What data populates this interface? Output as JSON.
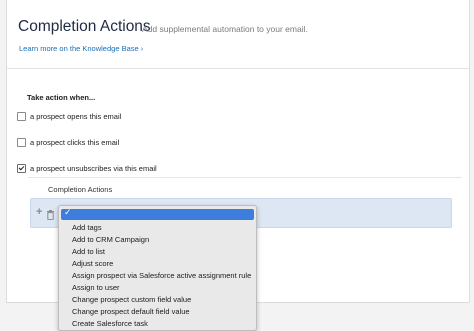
{
  "header": {
    "title": "Completion Actions",
    "subtitle": "Add supplemental automation to your email.",
    "kb_link": "Learn more on the Knowledge Base ›"
  },
  "trigger": {
    "heading": "Take action when...",
    "options": [
      {
        "label": "a prospect opens this email",
        "checked": false
      },
      {
        "label": "a prospect clicks this email",
        "checked": false
      },
      {
        "label": "a prospect unsubscribes via this email",
        "checked": true
      }
    ]
  },
  "completion_panel": {
    "title": "Completion Actions",
    "add_icon": "plus-icon",
    "delete_icon": "trash-icon"
  },
  "dropdown": {
    "selected_glyph": "✓",
    "items": [
      "Add tags",
      "Add to CRM Campaign",
      "Add to list",
      "Adjust score",
      "Assign prospect via Salesforce active assignment rule",
      "Assign to user",
      "Change prospect custom field value",
      "Change prospect default field value",
      "Create Salesforce task"
    ]
  },
  "colors": {
    "accent": "#3d7ddb",
    "link": "#1b6fb5",
    "row_highlight": "#dde7f3"
  }
}
